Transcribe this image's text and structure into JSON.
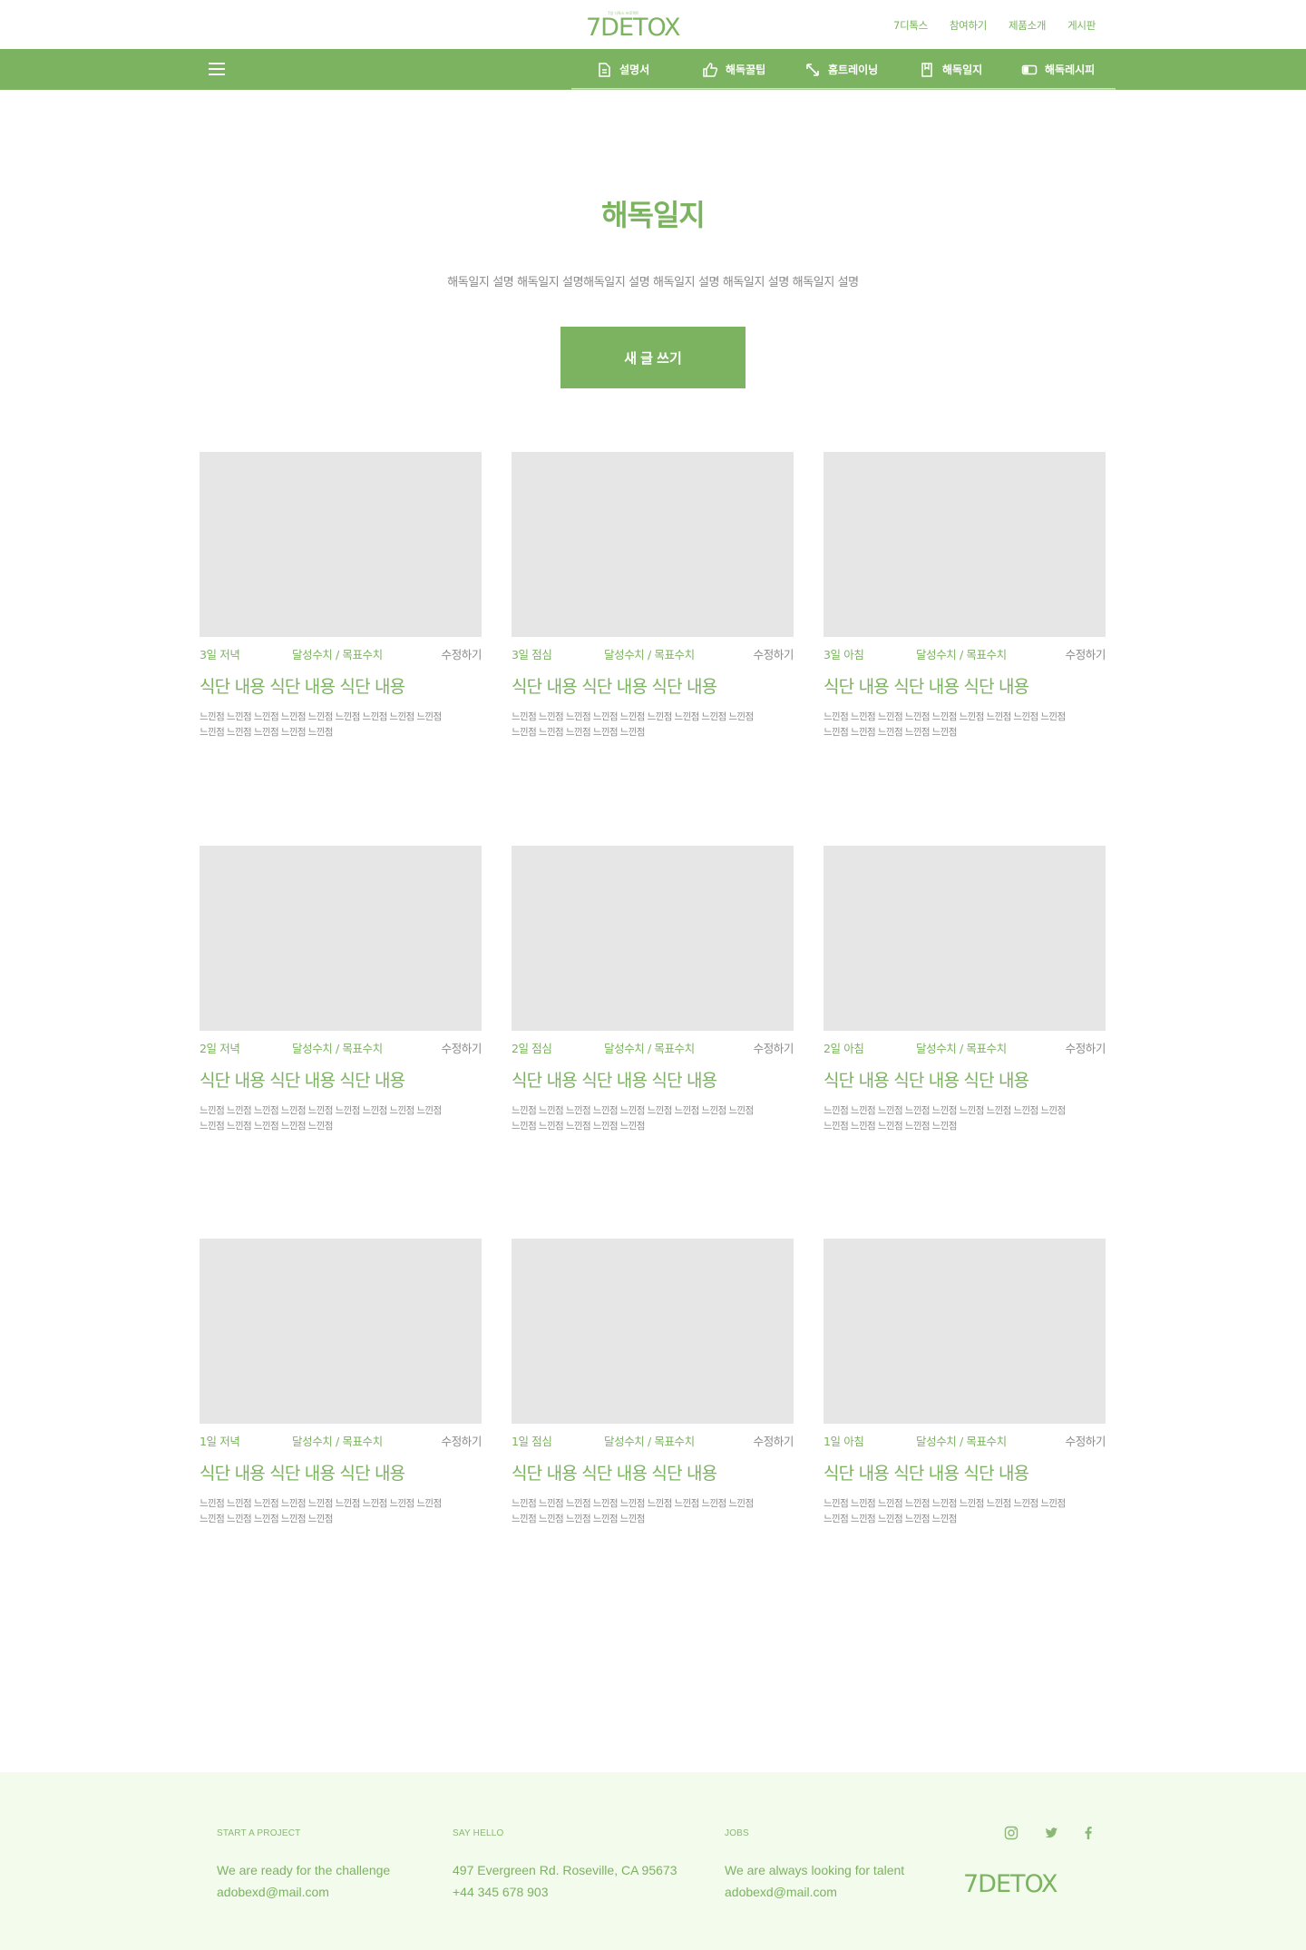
{
  "header": {
    "logo_text": "7DETOX",
    "logo_tagline": "7일 디톡스 프로젝트",
    "links": [
      "7디톡스",
      "참여하기",
      "제품소개",
      "게시판"
    ]
  },
  "nav": {
    "items": [
      {
        "label": "설명서",
        "icon": "document-icon"
      },
      {
        "label": "해독꿀팁",
        "icon": "thumbs-up-icon"
      },
      {
        "label": "홈트레이닝",
        "icon": "expand-icon"
      },
      {
        "label": "해독일지",
        "icon": "bookmark-icon"
      },
      {
        "label": "해독레시피",
        "icon": "toggle-icon"
      }
    ]
  },
  "hero": {
    "title": "해독일지",
    "description": "해독일지 설명 해독일지 설명해독일지 설명 해독일지 설명 해독일지 설명 해독일지 설명",
    "button": "새 글 쓰기"
  },
  "cards": [
    {
      "when": "3일 저녁",
      "score": "달성수치 / 목표수치",
      "edit": "수정하기",
      "title": "식단 내용 식단 내용 식단 내용",
      "body_line1": "느낀점 느낀점 느낀점 느낀점 느낀점 느낀점 느낀점 느낀점 느낀점",
      "body_line2": "느낀점 느낀점 느낀점 느낀점 느낀점"
    },
    {
      "when": "3일 점심",
      "score": "달성수치 / 목표수치",
      "edit": "수정하기",
      "title": "식단 내용 식단 내용 식단 내용",
      "body_line1": "느낀점 느낀점 느낀점 느낀점 느낀점 느낀점 느낀점 느낀점 느낀점",
      "body_line2": "느낀점 느낀점 느낀점 느낀점 느낀점"
    },
    {
      "when": "3일 아침",
      "score": "달성수치 / 목표수치",
      "edit": "수정하기",
      "title": "식단 내용 식단 내용 식단 내용",
      "body_line1": "느낀점 느낀점 느낀점 느낀점 느낀점 느낀점 느낀점 느낀점 느낀점",
      "body_line2": "느낀점 느낀점 느낀점 느낀점 느낀점"
    },
    {
      "when": "2일 저녁",
      "score": "달성수치 / 목표수치",
      "edit": "수정하기",
      "title": "식단 내용 식단 내용 식단 내용",
      "body_line1": "느낀점 느낀점 느낀점 느낀점 느낀점 느낀점 느낀점 느낀점 느낀점",
      "body_line2": "느낀점 느낀점 느낀점 느낀점 느낀점"
    },
    {
      "when": "2일 점심",
      "score": "달성수치 / 목표수치",
      "edit": "수정하기",
      "title": "식단 내용 식단 내용 식단 내용",
      "body_line1": "느낀점 느낀점 느낀점 느낀점 느낀점 느낀점 느낀점 느낀점 느낀점",
      "body_line2": "느낀점 느낀점 느낀점 느낀점 느낀점"
    },
    {
      "when": "2일 아침",
      "score": "달성수치 / 목표수치",
      "edit": "수정하기",
      "title": "식단 내용 식단 내용 식단 내용",
      "body_line1": "느낀점 느낀점 느낀점 느낀점 느낀점 느낀점 느낀점 느낀점 느낀점",
      "body_line2": "느낀점 느낀점 느낀점 느낀점 느낀점"
    },
    {
      "when": "1일 저녁",
      "score": "달성수치 / 목표수치",
      "edit": "수정하기",
      "title": "식단 내용 식단 내용 식단 내용",
      "body_line1": "느낀점 느낀점 느낀점 느낀점 느낀점 느낀점 느낀점 느낀점 느낀점",
      "body_line2": "느낀점 느낀점 느낀점 느낀점 느낀점"
    },
    {
      "when": "1일 점심",
      "score": "달성수치 / 목표수치",
      "edit": "수정하기",
      "title": "식단 내용 식단 내용 식단 내용",
      "body_line1": "느낀점 느낀점 느낀점 느낀점 느낀점 느낀점 느낀점 느낀점 느낀점",
      "body_line2": "느낀점 느낀점 느낀점 느낀점 느낀점"
    },
    {
      "when": "1일 아침",
      "score": "달성수치 / 목표수치",
      "edit": "수정하기",
      "title": "식단 내용 식단 내용 식단 내용",
      "body_line1": "느낀점 느낀점 느낀점 느낀점 느낀점 느낀점 느낀점 느낀점 느낀점",
      "body_line2": "느낀점 느낀점 느낀점 느낀점 느낀점"
    }
  ],
  "footer": {
    "project": {
      "heading": "START A PROJECT",
      "line1": "We are ready for the challenge",
      "line2": "adobexd@mail.com"
    },
    "hello": {
      "heading": "SAY HELLO",
      "line1": "497 Evergreen Rd. Roseville, CA 95673",
      "line2": "+44 345 678 903"
    },
    "jobs": {
      "heading": "JOBS",
      "line1": "We are always looking for talent",
      "line2": "adobexd@mail.com"
    },
    "social": [
      "instagram-icon",
      "twitter-icon",
      "facebook-icon"
    ],
    "logo_text": "7DETOX"
  },
  "colors": {
    "brand": "#7cb360",
    "placeholder": "#e6e6e6",
    "footer_bg": "#f2fbec",
    "muted": "#8a8a8a"
  }
}
